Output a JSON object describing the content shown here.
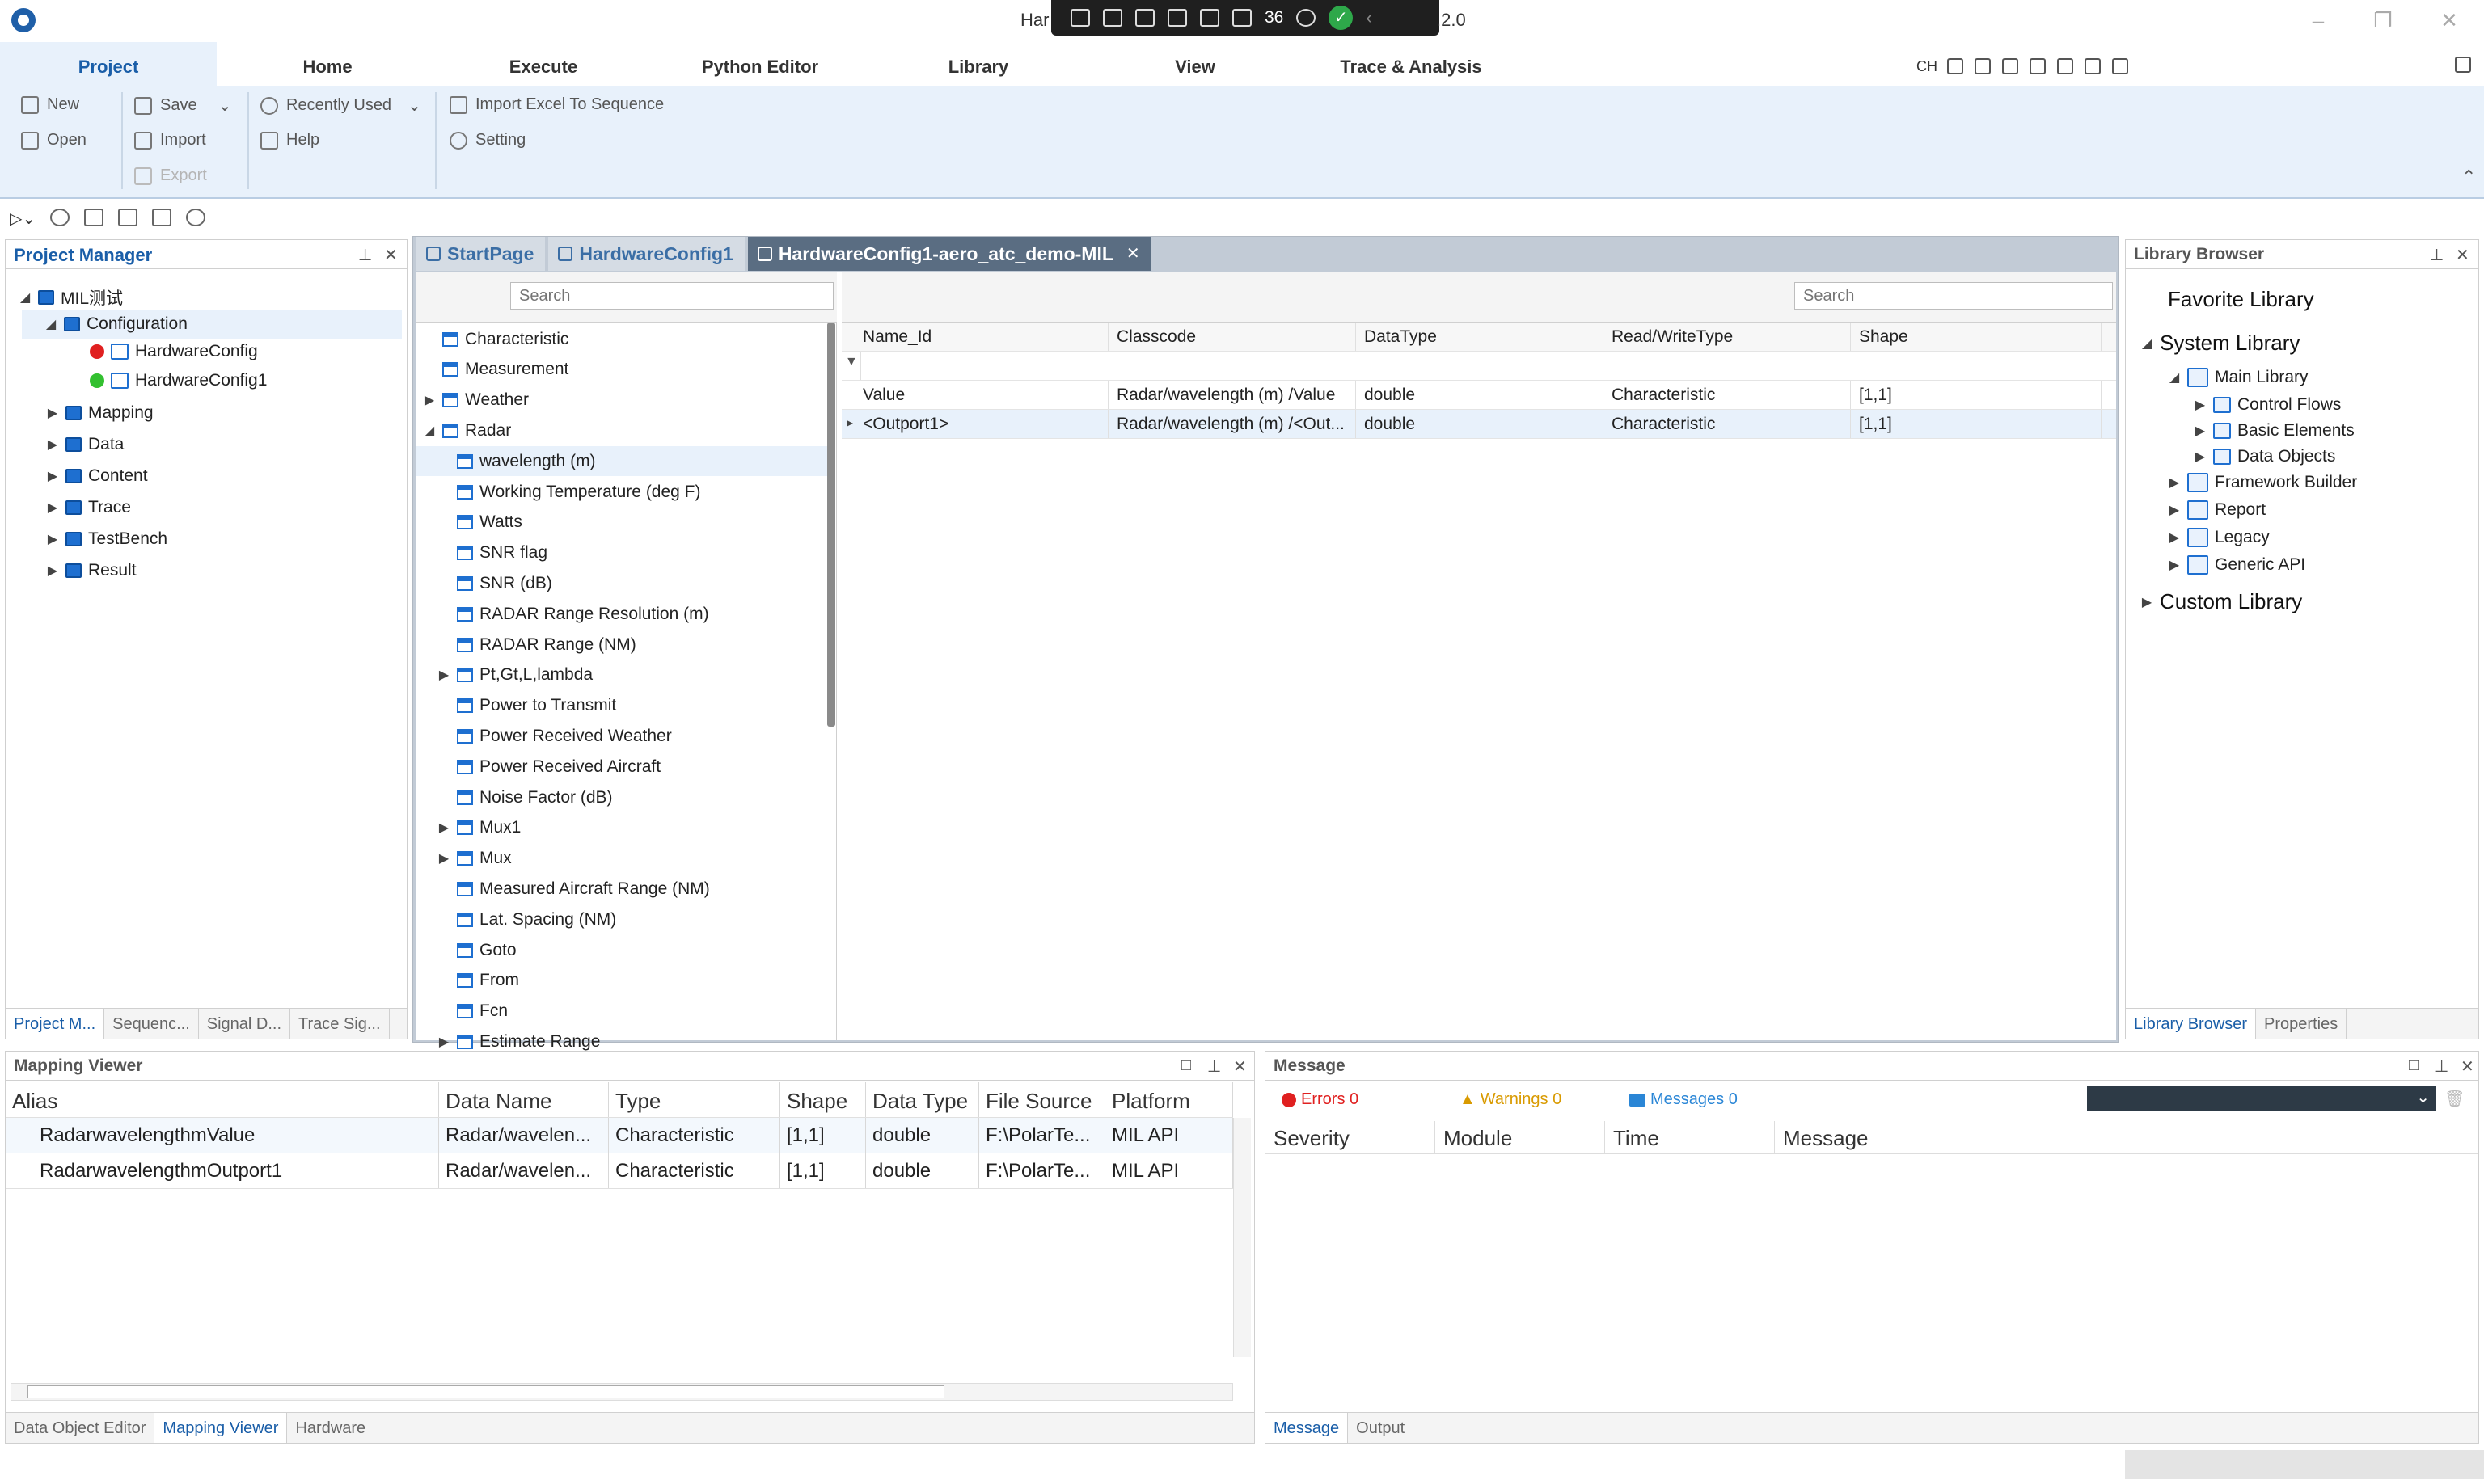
{
  "title_bar": {
    "title_prefix": "Har",
    "version_suffix": ".2.0",
    "recording_count": "36"
  },
  "ribbon": {
    "tabs": [
      "Project",
      "Home",
      "Execute",
      "Python Editor",
      "Library",
      "View",
      "Trace & Analysis"
    ],
    "buttons": {
      "new": "New",
      "open": "Open",
      "save": "Save",
      "import": "Import",
      "export": "Export",
      "recently_used": "Recently Used",
      "help": "Help",
      "import_excel": "Import Excel To Sequence",
      "setting": "Setting"
    },
    "right_tools_label": "CH"
  },
  "project_manager": {
    "title": "Project Manager",
    "tree": {
      "root": "MIL测试",
      "configuration": "Configuration",
      "hw1": "HardwareConfig",
      "hw2": "HardwareConfig1",
      "items": [
        "Mapping",
        "Data",
        "Content",
        "Trace",
        "TestBench",
        "Result"
      ]
    },
    "bottom_tabs": [
      "Project M...",
      "Sequenc...",
      "Signal D...",
      "Trace Sig..."
    ]
  },
  "editor": {
    "tabs": [
      "StartPage",
      "HardwareConfig1",
      "HardwareConfig1-aero_atc_demo-MIL"
    ],
    "left_search_placeholder": "Search",
    "right_search_placeholder": "Search",
    "tree": [
      {
        "label": "Characteristic",
        "level": 0,
        "expander": ""
      },
      {
        "label": "Measurement",
        "level": 0,
        "expander": ""
      },
      {
        "label": "Weather",
        "level": 0,
        "expander": "collapsed"
      },
      {
        "label": "Radar",
        "level": 0,
        "expander": "expanded"
      },
      {
        "label": "wavelength (m)",
        "level": 1,
        "expander": "",
        "selected": true
      },
      {
        "label": "Working Temperature (deg F)",
        "level": 1,
        "expander": ""
      },
      {
        "label": "Watts",
        "level": 1,
        "expander": ""
      },
      {
        "label": "SNR flag",
        "level": 1,
        "expander": ""
      },
      {
        "label": "SNR  (dB)",
        "level": 1,
        "expander": ""
      },
      {
        "label": "RADAR Range  Resolution (m)",
        "level": 1,
        "expander": ""
      },
      {
        "label": "RADAR Range  (NM)",
        "level": 1,
        "expander": ""
      },
      {
        "label": "Pt,Gt,L,lambda",
        "level": 1,
        "expander": "collapsed"
      },
      {
        "label": "Power to Transmit",
        "level": 1,
        "expander": ""
      },
      {
        "label": "Power Received Weather",
        "level": 1,
        "expander": ""
      },
      {
        "label": "Power Received Aircraft",
        "level": 1,
        "expander": ""
      },
      {
        "label": "Noise Factor (dB)",
        "level": 1,
        "expander": ""
      },
      {
        "label": "Mux1",
        "level": 1,
        "expander": "collapsed"
      },
      {
        "label": "Mux",
        "level": 1,
        "expander": "collapsed"
      },
      {
        "label": "Measured Aircraft Range (NM)",
        "level": 1,
        "expander": ""
      },
      {
        "label": "Lat. Spacing (NM)",
        "level": 1,
        "expander": ""
      },
      {
        "label": "Goto",
        "level": 1,
        "expander": ""
      },
      {
        "label": "From",
        "level": 1,
        "expander": ""
      },
      {
        "label": "Fcn",
        "level": 1,
        "expander": ""
      },
      {
        "label": "Estimate Range",
        "level": 1,
        "expander": "collapsed"
      }
    ],
    "grid": {
      "headers": [
        "Name_Id",
        "Classcode",
        "DataType",
        "Read/WriteType",
        "Shape"
      ],
      "rows": [
        [
          "Value",
          "Radar/wavelength (m) /Value",
          "double",
          "Characteristic",
          "[1,1]"
        ],
        [
          "<Outport1>",
          "Radar/wavelength (m) /<Out...",
          "double",
          "Characteristic",
          "[1,1]"
        ]
      ]
    }
  },
  "library_browser": {
    "title": "Library Browser",
    "favorite": "Favorite Library",
    "system": "System Library",
    "main": "Main Library",
    "main_children": [
      "Control Flows",
      "Basic Elements",
      "Data Objects"
    ],
    "others": [
      "Framework Builder",
      "Report",
      "Legacy",
      "Generic API"
    ],
    "custom": "Custom Library",
    "bottom_tabs": [
      "Library Browser",
      "Properties"
    ]
  },
  "mapping_viewer": {
    "title": "Mapping Viewer",
    "headers": [
      "Alias",
      "Data Name",
      "Type",
      "Shape",
      "Data Type",
      "File Source",
      "Platform"
    ],
    "rows": [
      [
        "RadarwavelengthmValue",
        "Radar/wavelen...",
        "Characteristic",
        "[1,1]",
        "double",
        "F:\\PolarTe...",
        "MIL API"
      ],
      [
        "RadarwavelengthmOutport1",
        "Radar/wavelen...",
        "Characteristic",
        "[1,1]",
        "double",
        "F:\\PolarTe...",
        "MIL API"
      ]
    ],
    "bottom_tabs": [
      "Data Object Editor",
      "Mapping Viewer",
      "Hardware"
    ]
  },
  "message": {
    "title": "Message",
    "errors": "Errors 0",
    "warnings": "Warnings 0",
    "messages": "Messages 0",
    "headers": [
      "Severity",
      "Module",
      "Time",
      "Message"
    ],
    "bottom_tabs": [
      "Message",
      "Output"
    ]
  },
  "colors": {
    "accent": "#1a5ea8",
    "ribbon_bg": "#e8f1fb",
    "error": "#e02020",
    "warning": "#d99a00",
    "info": "#2a86d6"
  }
}
